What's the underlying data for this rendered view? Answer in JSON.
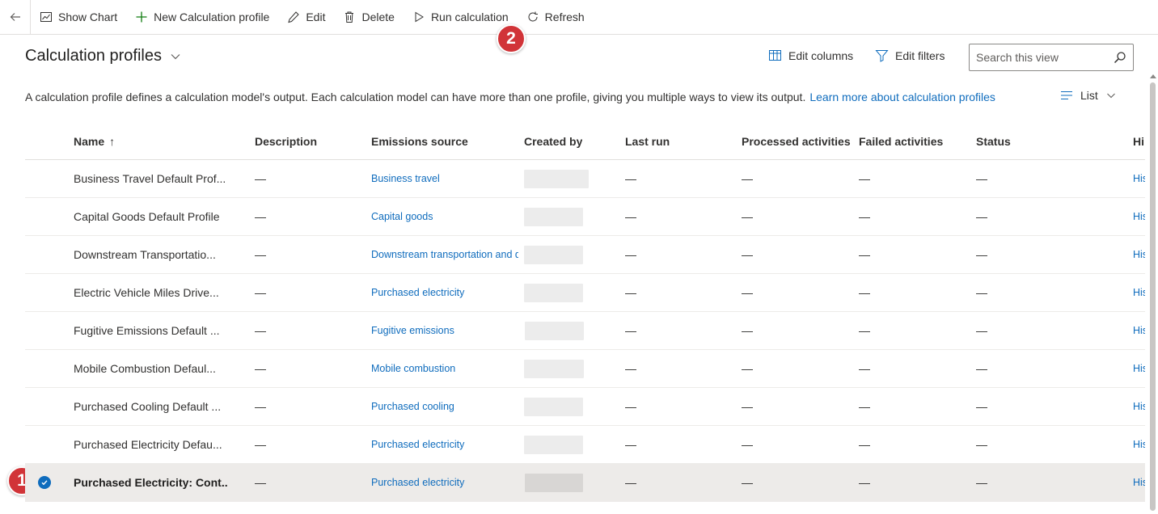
{
  "toolbar": {
    "show_chart": "Show Chart",
    "new_profile": "New Calculation profile",
    "edit": "Edit",
    "delete": "Delete",
    "run_calculation": "Run calculation",
    "refresh": "Refresh"
  },
  "callouts": [
    "1",
    "2"
  ],
  "view": {
    "title": "Calculation profiles",
    "edit_columns": "Edit columns",
    "edit_filters": "Edit filters",
    "search_placeholder": "Search this view",
    "description": "A calculation profile defines a calculation model's output. Each calculation model can have more than one profile, giving you multiple ways to view its output.",
    "learn_more": "Learn more about calculation profiles",
    "list_label": "List"
  },
  "columns": {
    "name": "Name",
    "sort_indicator": "↑",
    "description": "Description",
    "emissions_source": "Emissions source",
    "created_by": "Created by",
    "last_run": "Last run",
    "processed": "Processed activities",
    "failed": "Failed activities",
    "status": "Status",
    "history": "Hi"
  },
  "rows": [
    {
      "name": "Business Travel Default Prof...",
      "desc": "—",
      "source": "Business travel",
      "last": "—",
      "proc": "—",
      "fail": "—",
      "status": "—",
      "hist": "His"
    },
    {
      "name": "Capital Goods Default Profile",
      "desc": "—",
      "source": "Capital goods",
      "last": "—",
      "proc": "—",
      "fail": "—",
      "status": "—",
      "hist": "His"
    },
    {
      "name": "Downstream Transportatio...",
      "desc": "—",
      "source": "Downstream transportation and di",
      "last": "—",
      "proc": "—",
      "fail": "—",
      "status": "—",
      "hist": "His"
    },
    {
      "name": "Electric Vehicle Miles Drive...",
      "desc": "—",
      "source": "Purchased electricity",
      "last": "—",
      "proc": "—",
      "fail": "—",
      "status": "—",
      "hist": "His"
    },
    {
      "name": "Fugitive Emissions Default ...",
      "desc": "—",
      "source": "Fugitive emissions",
      "last": "—",
      "proc": "—",
      "fail": "—",
      "status": "—",
      "hist": "His"
    },
    {
      "name": "Mobile Combustion Defaul...",
      "desc": "—",
      "source": "Mobile combustion",
      "last": "—",
      "proc": "—",
      "fail": "—",
      "status": "—",
      "hist": "His"
    },
    {
      "name": "Purchased Cooling Default ...",
      "desc": "—",
      "source": "Purchased cooling",
      "last": "—",
      "proc": "—",
      "fail": "—",
      "status": "—",
      "hist": "His"
    },
    {
      "name": "Purchased Electricity Defau...",
      "desc": "—",
      "source": "Purchased electricity",
      "last": "—",
      "proc": "—",
      "fail": "—",
      "status": "—",
      "hist": "His"
    },
    {
      "name": "Purchased Electricity: Cont...",
      "desc": "—",
      "source": "Purchased electricity",
      "last": "—",
      "proc": "—",
      "fail": "—",
      "status": "—",
      "hist": "His"
    }
  ],
  "colors": {
    "accent": "#0f6cbd",
    "callout": "#d13438",
    "selected_row": "#edebe9"
  }
}
